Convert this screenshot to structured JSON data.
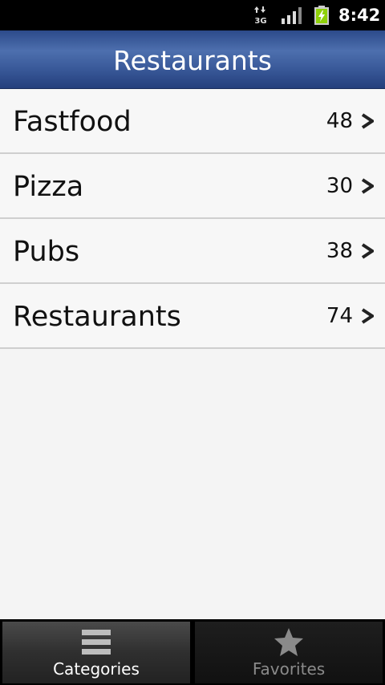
{
  "status_bar": {
    "network": "3G",
    "time": "8:42",
    "icons": [
      "network-3g-icon",
      "signal-icon",
      "battery-charging-icon"
    ]
  },
  "header": {
    "title": "Restaurants"
  },
  "categories": [
    {
      "label": "Fastfood",
      "count": "48"
    },
    {
      "label": "Pizza",
      "count": "30"
    },
    {
      "label": "Pubs",
      "count": "38"
    },
    {
      "label": "Restaurants",
      "count": "74"
    }
  ],
  "tabs": [
    {
      "label": "Categories",
      "icon": "list-icon",
      "selected": true
    },
    {
      "label": "Favorites",
      "icon": "star-icon",
      "selected": false
    }
  ],
  "colors": {
    "header_blue": "#3a5a9a",
    "list_background": "#f4f4f4",
    "divider": "#cfcfcf",
    "battery_green": "#8fd10a"
  }
}
